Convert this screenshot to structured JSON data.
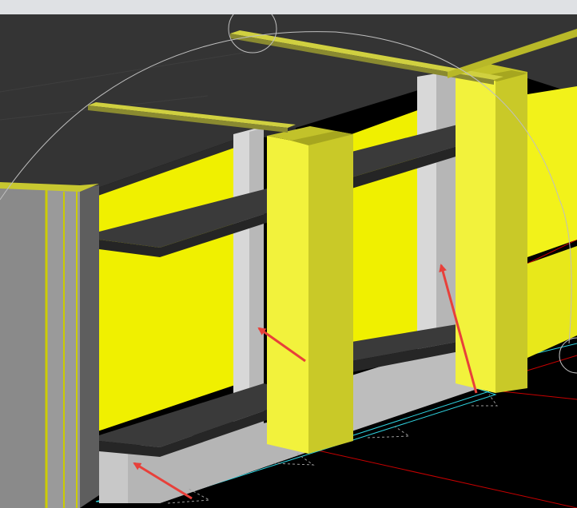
{
  "window": {
    "top_bar_color": "#dfe1e4"
  },
  "viewport": {
    "background": "#000000",
    "scene": "3d-model-view"
  },
  "colors": {
    "slab_top": "#343434",
    "slab_edge": "#2a2a2a",
    "wall_yellow": "#f0f000",
    "wall_yellow_shade": "#d8d800",
    "column_front": "#f2f23c",
    "column_side": "#c9c928",
    "column_top": "#c2c22a",
    "pier_light": "#d6d6d6",
    "pier_mid": "#bdbdbd",
    "pier_dark": "#9a9a9a",
    "end_wall": "#8a8a8a",
    "arrow": "#e8403a",
    "cad_red_line": "#c80000",
    "cad_cyan_line": "#2fd3e0",
    "guide_circle": "#bfbfbf"
  },
  "annotations": {
    "arrow_count": 3
  }
}
